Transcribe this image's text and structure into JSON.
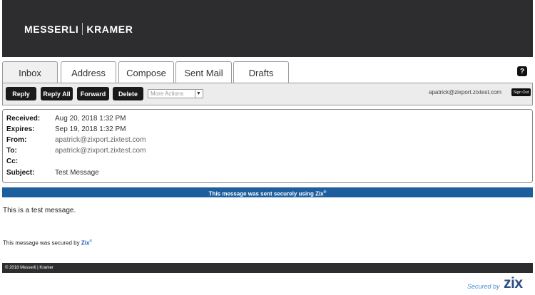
{
  "header": {
    "logo_left": "MESSERLI",
    "logo_right": "KRAMER"
  },
  "tabs": [
    {
      "label": "Inbox",
      "active": true
    },
    {
      "label": "Address",
      "active": false
    },
    {
      "label": "Compose",
      "active": false
    },
    {
      "label": "Sent Mail",
      "active": false
    },
    {
      "label": "Drafts",
      "active": false
    }
  ],
  "help": {
    "label": "?"
  },
  "toolbar": {
    "reply_label": "Reply",
    "reply_all_label": "Reply All",
    "forward_label": "Forward",
    "delete_label": "Delete",
    "more_actions_selected": "More Actions",
    "user_email": "apatrick@zixport.zixtest.com",
    "sign_out_label": "Sign Out"
  },
  "message": {
    "received_label": "Received:",
    "received": "Aug 20, 2018 1:32 PM",
    "expires_label": "Expires:",
    "expires": "Sep 19, 2018 1:32 PM",
    "from_label": "From:",
    "from": "apatrick@zixport.zixtest.com",
    "to_label": "To:",
    "to": "apatrick@zixport.zixtest.com",
    "cc_label": "Cc:",
    "cc": "",
    "subject_label": "Subject:",
    "subject": "Test Message",
    "body": "This is a test message."
  },
  "banner": {
    "text": "This message was sent securely using Zix",
    "mark": "®"
  },
  "secured": {
    "prefix": "This message was secured by ",
    "brand": "Zix",
    "mark": "®"
  },
  "footer": {
    "copyright": "© 2018 Messerli | Kramer"
  },
  "badge": {
    "secured_by": "Secured by",
    "brand": "zix"
  },
  "colors": {
    "header_bg": "#2d2d2f",
    "banner_bg": "#1d5f9e",
    "zix_blue": "#1d5fb0"
  }
}
